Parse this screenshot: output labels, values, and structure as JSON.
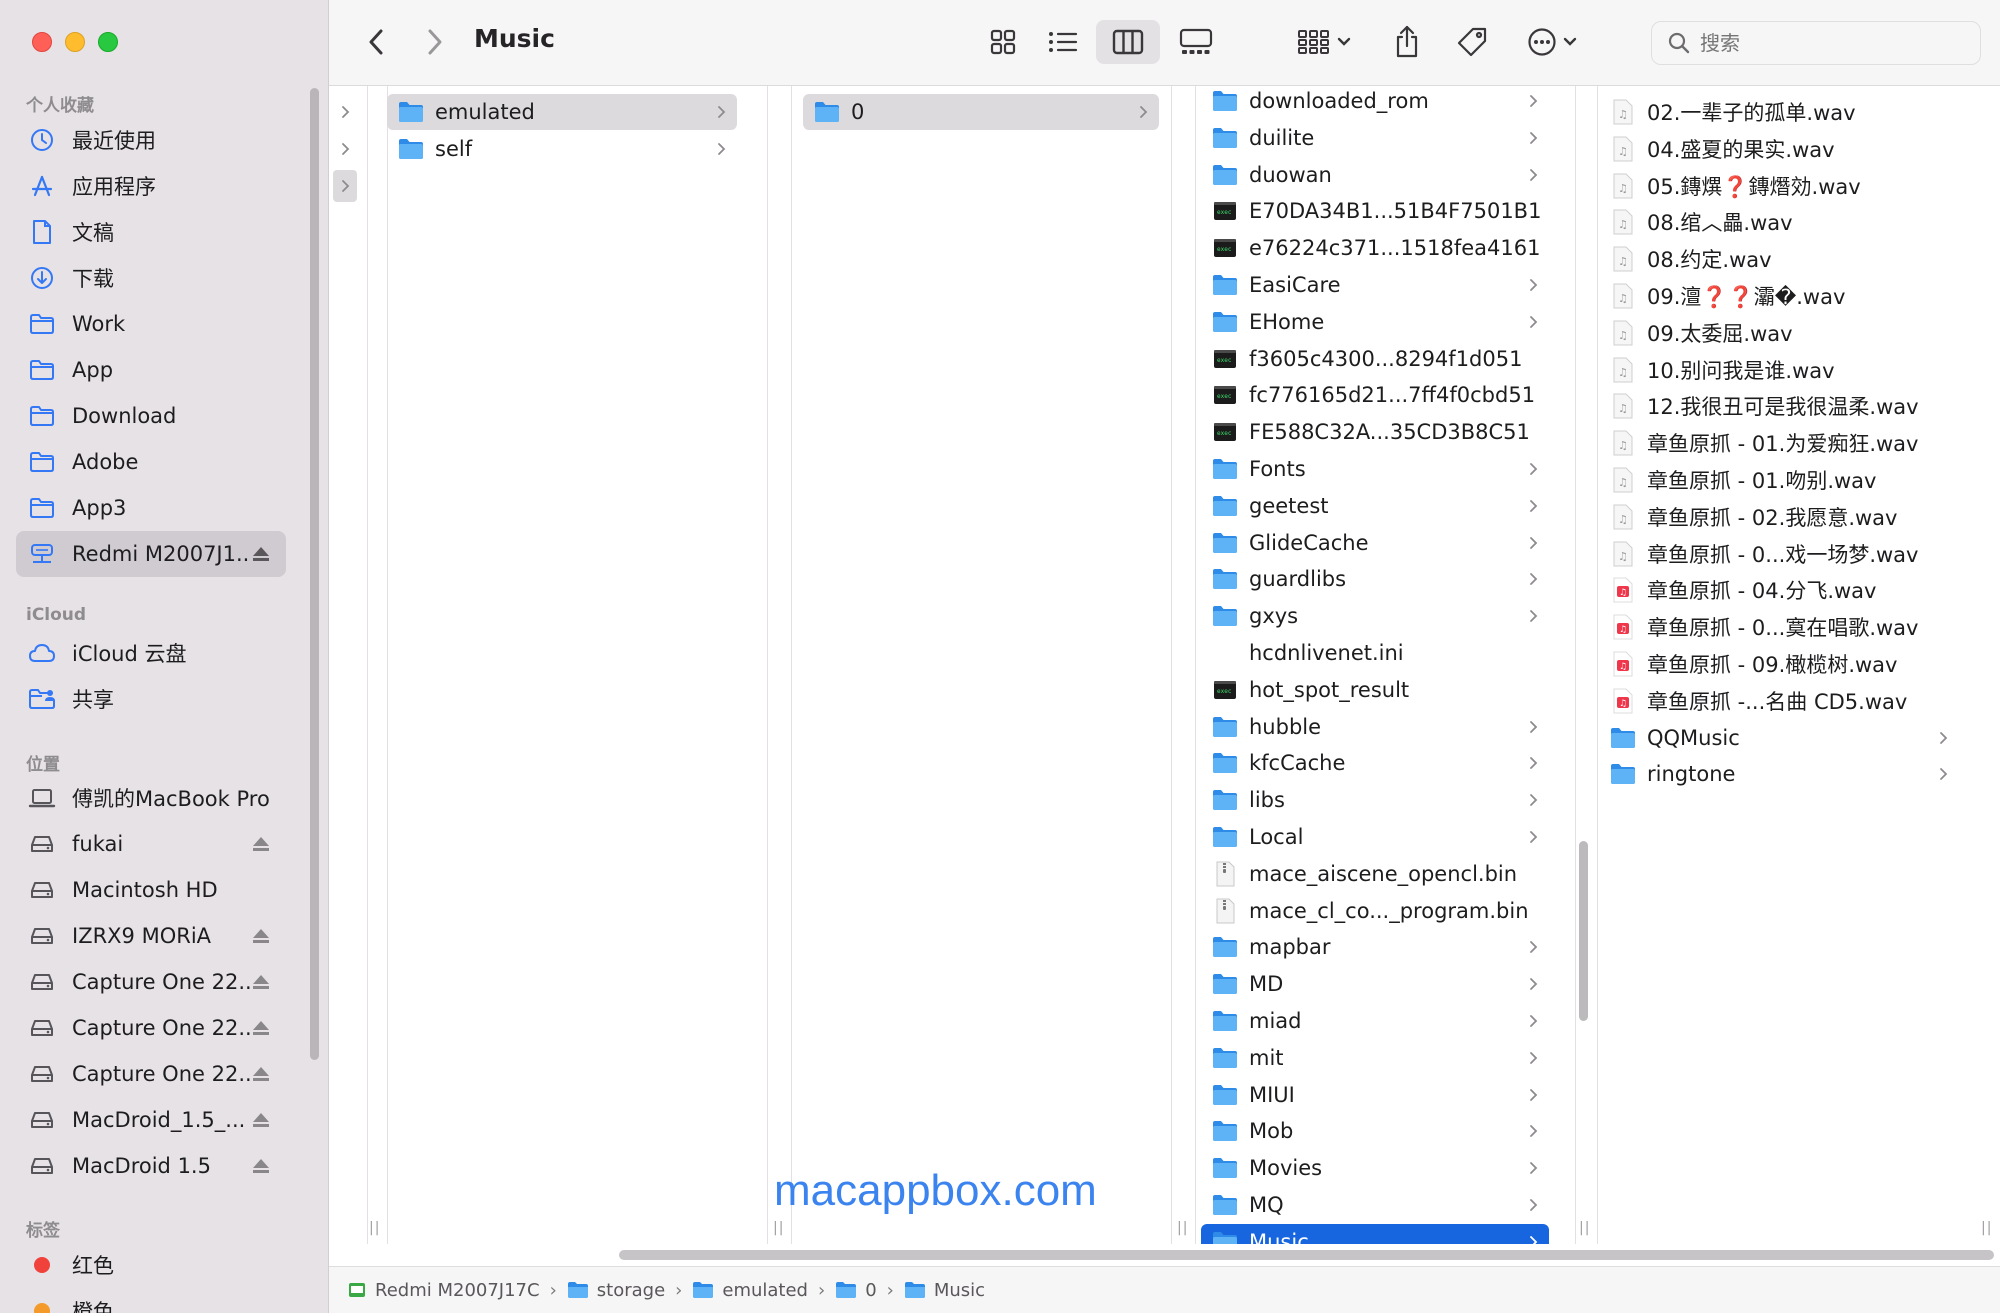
{
  "window": {
    "title": "Music"
  },
  "toolbar": {
    "search_placeholder": "搜索",
    "icons": [
      "chevron-left-icon",
      "chevron-right-icon",
      "grid-view-icon",
      "list-view-icon",
      "column-view-icon",
      "gallery-view-icon",
      "group-icon",
      "share-icon",
      "tag-icon",
      "more-icon"
    ]
  },
  "sidebar": {
    "favorites_label": "个人收藏",
    "favorites": [
      {
        "label": "最近使用",
        "icon": "clock-icon"
      },
      {
        "label": "应用程序",
        "icon": "apps-icon"
      },
      {
        "label": "文稿",
        "icon": "document-icon"
      },
      {
        "label": "下载",
        "icon": "download-icon"
      },
      {
        "label": "Work",
        "icon": "folder-icon"
      },
      {
        "label": "App",
        "icon": "folder-icon"
      },
      {
        "label": "Download",
        "icon": "folder-icon"
      },
      {
        "label": "Adobe",
        "icon": "folder-icon"
      },
      {
        "label": "App3",
        "icon": "folder-icon"
      },
      {
        "label": "Redmi M2007J1...",
        "icon": "network-drive-icon",
        "selected": true,
        "eject": true
      }
    ],
    "icloud_label": "iCloud",
    "icloud": [
      {
        "label": "iCloud 云盘",
        "icon": "cloud-icon"
      },
      {
        "label": "共享",
        "icon": "shared-folder-icon"
      }
    ],
    "locations_label": "位置",
    "locations": [
      {
        "label": "傅凯的MacBook Pro",
        "icon": "laptop-icon",
        "eject": false
      },
      {
        "label": "fukai",
        "icon": "drive-icon",
        "eject": true
      },
      {
        "label": "Macintosh HD",
        "icon": "drive-icon",
        "eject": false
      },
      {
        "label": "IZRX9 MORiA",
        "icon": "drive-icon",
        "eject": true
      },
      {
        "label": "Capture One 22...",
        "icon": "drive-icon",
        "eject": true
      },
      {
        "label": "Capture One 22...",
        "icon": "drive-icon",
        "eject": true
      },
      {
        "label": "Capture One 22...",
        "icon": "drive-icon",
        "eject": true
      },
      {
        "label": "MacDroid_1.5_...",
        "icon": "drive-icon",
        "eject": true
      },
      {
        "label": "MacDroid 1.5",
        "icon": "drive-icon",
        "eject": true
      }
    ],
    "tags_label": "标签",
    "tags": [
      {
        "label": "红色",
        "color": "#f0413b"
      },
      {
        "label": "橙色",
        "color": "#f39a2b"
      }
    ]
  },
  "columns": {
    "col1": [
      {
        "label": "emulated",
        "type": "folder",
        "selected": true
      },
      {
        "label": "self",
        "type": "folder"
      }
    ],
    "col2": [
      {
        "label": "0",
        "type": "folder",
        "selected": true
      }
    ],
    "col3": [
      {
        "label": "downloaded_rom",
        "type": "folder"
      },
      {
        "label": "duilite",
        "type": "folder"
      },
      {
        "label": "duowan",
        "type": "folder"
      },
      {
        "label": "E70DA34B1...51B4F7501B1",
        "type": "exec"
      },
      {
        "label": "e76224c371...1518fea4161",
        "type": "exec"
      },
      {
        "label": "EasiCare",
        "type": "folder"
      },
      {
        "label": "EHome",
        "type": "folder"
      },
      {
        "label": "f3605c4300...8294f1d051",
        "type": "exec"
      },
      {
        "label": "fc776165d21...7ff4f0cbd51",
        "type": "exec"
      },
      {
        "label": "FE588C32A...35CD3B8C51",
        "type": "exec"
      },
      {
        "label": "Fonts",
        "type": "folder"
      },
      {
        "label": "geetest",
        "type": "folder"
      },
      {
        "label": "GlideCache",
        "type": "folder"
      },
      {
        "label": "guardlibs",
        "type": "folder"
      },
      {
        "label": "gxys",
        "type": "folder"
      },
      {
        "label": "hcdnlivenet.ini",
        "type": "blank"
      },
      {
        "label": "hot_spot_result",
        "type": "exec"
      },
      {
        "label": "hubble",
        "type": "folder"
      },
      {
        "label": "kfcCache",
        "type": "folder"
      },
      {
        "label": "libs",
        "type": "folder"
      },
      {
        "label": "Local",
        "type": "folder"
      },
      {
        "label": "mace_aiscene_opencl.bin",
        "type": "zip"
      },
      {
        "label": "mace_cl_co..._program.bin",
        "type": "zip"
      },
      {
        "label": "mapbar",
        "type": "folder"
      },
      {
        "label": "MD",
        "type": "folder"
      },
      {
        "label": "miad",
        "type": "folder"
      },
      {
        "label": "mit",
        "type": "folder"
      },
      {
        "label": "MIUI",
        "type": "folder"
      },
      {
        "label": "Mob",
        "type": "folder"
      },
      {
        "label": "Movies",
        "type": "folder"
      },
      {
        "label": "MQ",
        "type": "folder"
      },
      {
        "label": "Music",
        "type": "folder",
        "selected": true
      }
    ],
    "col4": [
      {
        "label": "02.一辈子的孤单.wav",
        "type": "audio"
      },
      {
        "label": "04.盛夏的果实.wav",
        "type": "audio"
      },
      {
        "label": "05.鏄熼❓鏄熸効.wav",
        "type": "audio"
      },
      {
        "label": "08.绾︿畾.wav",
        "type": "audio"
      },
      {
        "label": "08.约定.wav",
        "type": "audio"
      },
      {
        "label": "09.澶❓❓灞�.wav",
        "type": "audio"
      },
      {
        "label": "09.太委屈.wav",
        "type": "audio"
      },
      {
        "label": "10.别问我是谁.wav",
        "type": "audio"
      },
      {
        "label": "12.我很丑可是我很温柔.wav",
        "type": "audio"
      },
      {
        "label": "章鱼原抓 - 01.为爱痴狂.wav",
        "type": "audio"
      },
      {
        "label": "章鱼原抓 - 01.吻别.wav",
        "type": "audio"
      },
      {
        "label": "章鱼原抓 - 02.我愿意.wav",
        "type": "audio"
      },
      {
        "label": "章鱼原抓 - 0...戏一场梦.wav",
        "type": "audio"
      },
      {
        "label": "章鱼原抓 - 04.分飞.wav",
        "type": "audio-red"
      },
      {
        "label": "章鱼原抓 - 0...寞在唱歌.wav",
        "type": "audio-red"
      },
      {
        "label": "章鱼原抓 - 09.橄榄树.wav",
        "type": "audio-red"
      },
      {
        "label": "章鱼原抓 -...名曲 CD5.wav",
        "type": "audio-red"
      },
      {
        "label": "QQMusic",
        "type": "folder"
      },
      {
        "label": "ringtone",
        "type": "folder"
      }
    ]
  },
  "watermark": "macappbox.com",
  "pathbar": [
    {
      "label": "Redmi M2007J17C",
      "icon": "device-icon"
    },
    {
      "label": "storage",
      "icon": "folder-icon"
    },
    {
      "label": "emulated",
      "icon": "folder-icon"
    },
    {
      "label": "0",
      "icon": "folder-icon"
    },
    {
      "label": "Music",
      "icon": "folder-icon"
    }
  ],
  "colors": {
    "accent": "#1865e0",
    "folder": "#3a9af0",
    "sidebar_bg": "#e6e2e6"
  }
}
